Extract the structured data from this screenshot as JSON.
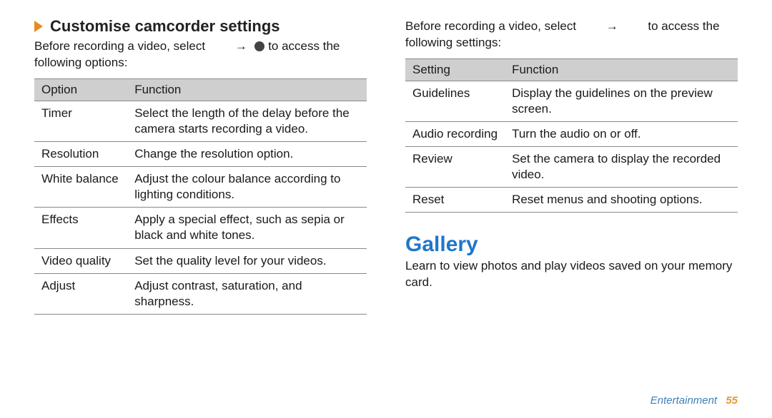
{
  "left": {
    "heading": "Customise camcorder settings",
    "lead_pre": "Before recording a video, select",
    "lead_arrow": "→",
    "lead_post": "to access the following options:",
    "table": {
      "head": {
        "col1": "Option",
        "col2": "Function"
      },
      "rows": [
        {
          "name": "Timer",
          "desc": "Select the length of the delay before the camera starts recording a video."
        },
        {
          "name": "Resolution",
          "desc": "Change the resolution option."
        },
        {
          "name": "White balance",
          "desc": "Adjust the colour balance according to lighting conditions."
        },
        {
          "name": "Effects",
          "desc": "Apply a special effect, such as sepia or black and white tones."
        },
        {
          "name": "Video quality",
          "desc": "Set the quality level for your videos."
        },
        {
          "name": "Adjust",
          "desc": "Adjust contrast, saturation, and sharpness."
        }
      ]
    }
  },
  "right": {
    "lead_pre": "Before recording a video, select",
    "lead_arrow": "→",
    "lead_post": "to access the following settings:",
    "table": {
      "head": {
        "col1": "Setting",
        "col2": "Function"
      },
      "rows": [
        {
          "name": "Guidelines",
          "desc": "Display the guidelines on the preview screen."
        },
        {
          "name": "Audio recording",
          "desc": "Turn the audio on or off."
        },
        {
          "name": "Review",
          "desc": "Set the camera to display the recorded video."
        },
        {
          "name": "Reset",
          "desc": "Reset menus and shooting options."
        }
      ]
    },
    "gallery_heading": "Gallery",
    "gallery_lead": "Learn to view photos and play videos saved on your memory card."
  },
  "footer": {
    "section": "Entertainment",
    "page": "55"
  }
}
